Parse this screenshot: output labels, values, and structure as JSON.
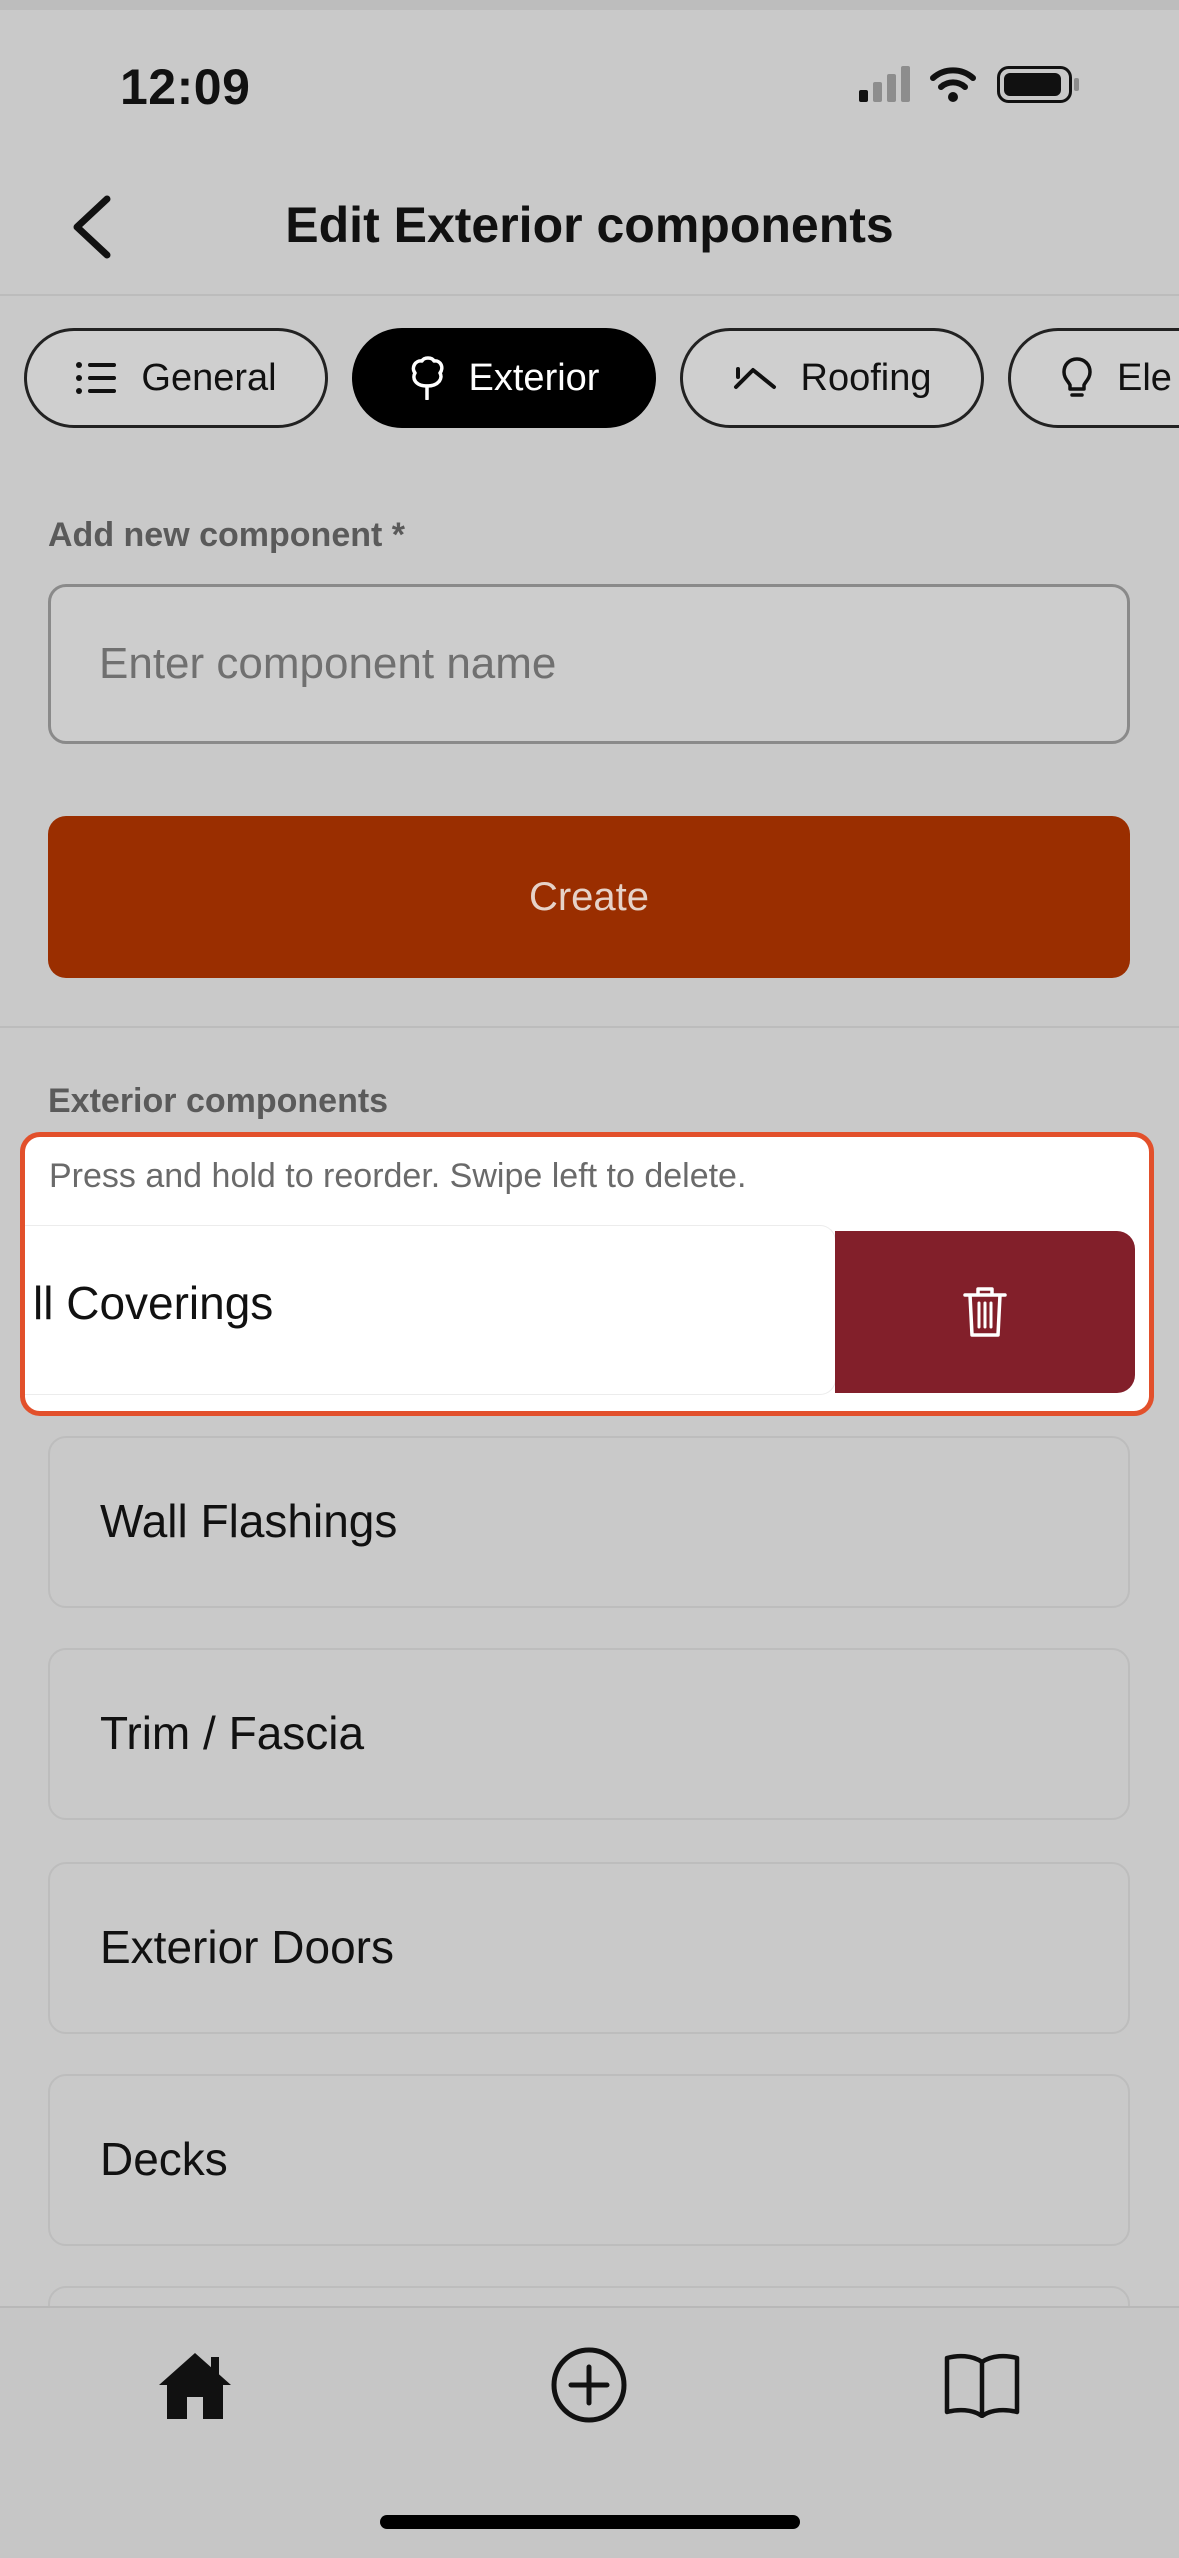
{
  "status_bar": {
    "time": "12:09"
  },
  "header": {
    "title": "Edit Exterior components",
    "back_icon": "chevron-left-icon"
  },
  "tabs": [
    {
      "label": "General",
      "icon": "list-icon",
      "active": false
    },
    {
      "label": "Exterior",
      "icon": "tree-icon",
      "active": true
    },
    {
      "label": "Roofing",
      "icon": "roof-icon",
      "active": false
    },
    {
      "label": "Ele",
      "icon": "lightbulb-icon",
      "active": false
    }
  ],
  "add_component": {
    "label": "Add new component *",
    "placeholder": "Enter component name",
    "value": "",
    "create_label": "Create"
  },
  "components": {
    "section_label": "Exterior components",
    "hint": "Press and hold to reorder. Swipe left to delete.",
    "swiped_item": {
      "label": "ll Coverings",
      "delete_icon": "trash-icon"
    },
    "items": [
      "Wall Flashings",
      "Trim / Fascia",
      "Exterior Doors",
      "Decks"
    ]
  },
  "bottom_nav": [
    {
      "icon": "home-icon"
    },
    {
      "icon": "plus-circle-icon"
    },
    {
      "icon": "book-icon"
    }
  ],
  "colors": {
    "accent": "#9a2e00",
    "delete": "#821f2a",
    "highlight_border": "#e2502b",
    "background": "#c9c9c9"
  }
}
